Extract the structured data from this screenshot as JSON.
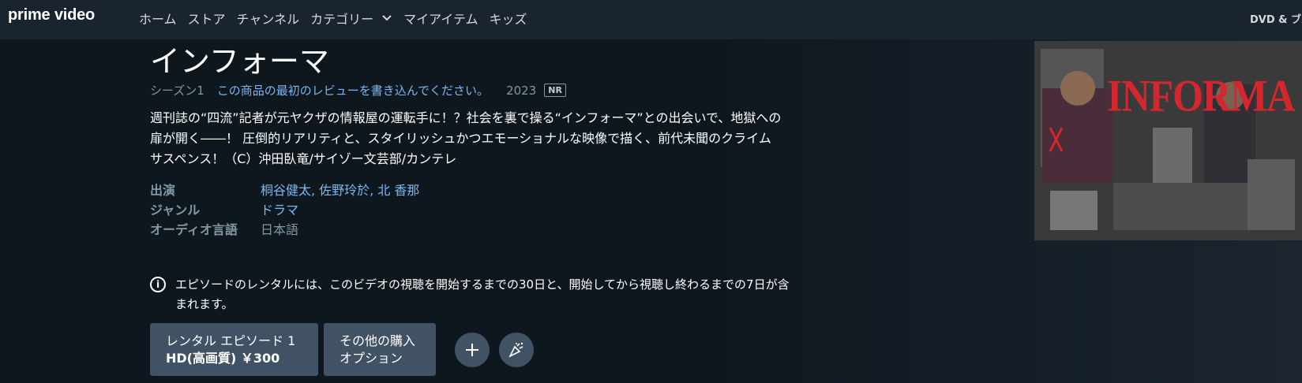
{
  "header": {
    "logo": "prime video",
    "nav": [
      {
        "label": "ホーム"
      },
      {
        "label": "ストア"
      },
      {
        "label": "チャンネル"
      },
      {
        "label": "カテゴリー"
      },
      {
        "label": "マイアイテム"
      },
      {
        "label": "キッズ"
      }
    ],
    "right_link": "DVD & ブル"
  },
  "title": "インフォーマ",
  "meta": {
    "season": "シーズン1",
    "review_link": "この商品の最初のレビューを書き込んでください。",
    "year": "2023",
    "rating": "NR"
  },
  "synopsis": "週刊誌の“四流”記者が元ヤクザの情報屋の運転手に！？社会を裏で操る“インフォーマ”との出会いで、地獄への扉が開く――！ 圧倒的リアリティと、スタイリッシュかつエモーショナルな映像で描く、前代未聞のクライムサスペンス！（C）沖田臥竜/サイゾー文芸部/カンテレ",
  "details": [
    {
      "label": "出演",
      "value": "桐谷健太, 佐野玲於, 北 香那",
      "link": true
    },
    {
      "label": "ジャンル",
      "value": "ドラマ",
      "link": true
    },
    {
      "label": "オーディオ言語",
      "value": "日本語",
      "link": false
    }
  ],
  "notice": "エピソードのレンタルには、このビデオの視聴を開始するまでの30日と、開始してから視聴し終わるまでの7日が含まれます。",
  "buttons": {
    "rent_line1": "レンタル エピソード 1",
    "rent_line2": "HD(高画質) ￥300",
    "other_line1": "その他の購入",
    "other_line2": "オプション"
  },
  "poster": {
    "title_text": "INFORMA"
  },
  "icons": {
    "info": "info-icon",
    "add": "plus-icon",
    "watch_party": "party-icon",
    "dropdown": "chevron-down-icon"
  },
  "colors": {
    "background": "#0f171e",
    "topbar": "#1a242f",
    "link": "#79b8f3",
    "muted": "#8197a4",
    "button": "#425265"
  }
}
